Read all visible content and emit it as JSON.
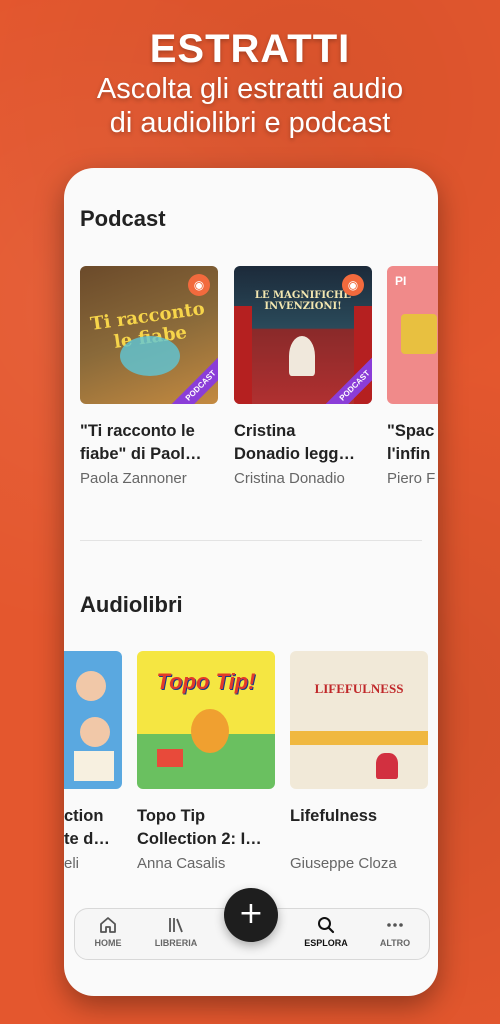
{
  "promo": {
    "title": "ESTRATTI",
    "subtitle_line1": "Ascolta gli estratti audio",
    "subtitle_line2": "di audiolibri e podcast"
  },
  "podcast_section": {
    "title": "Podcast",
    "items": [
      {
        "title": "\"Ti racconto le\nfiabe\" di Paol…",
        "author": "Paola Zannoner",
        "cover_text": "Ti racconto le fiabe"
      },
      {
        "title": "Cristina\nDonadio legg…",
        "author": "Cristina Donadio",
        "cover_text": "LE MAGNIFICHE INVENZIONI!"
      },
      {
        "title": "\"Spac\nl'infin",
        "author": "Piero F",
        "cover_text": "PI"
      }
    ]
  },
  "audiobook_section": {
    "title": "Audiolibri",
    "items": [
      {
        "title": "ction\nte d…",
        "author": "eli"
      },
      {
        "title": "Topo Tip\nCollection 2: I…",
        "author": "Anna Casalis",
        "cover_text": "Topo Tip!"
      },
      {
        "title": "Lifefulness",
        "author": "Giuseppe Cloza",
        "cover_text": "LIFEFULNESS"
      }
    ]
  },
  "nav": {
    "items": [
      {
        "label": "HOME",
        "icon": "home-icon"
      },
      {
        "label": "LIBRERIA",
        "icon": "library-icon"
      },
      {
        "label": "ESPLORA",
        "icon": "search-icon"
      },
      {
        "label": "ALTRO",
        "icon": "more-icon"
      }
    ],
    "fab_label": "+"
  },
  "colors": {
    "background": "#e4572e",
    "podcast_badge": "#f26a3d",
    "ribbon": "#8b3dd8"
  }
}
